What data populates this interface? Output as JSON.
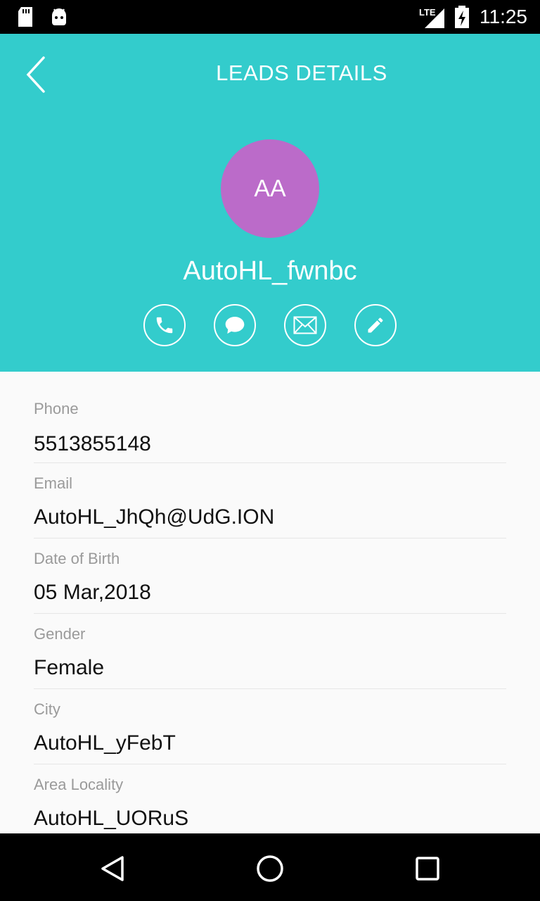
{
  "status_bar": {
    "network": "LTE",
    "time": "11:25"
  },
  "header": {
    "title": "LEADS DETAILS",
    "avatar_initials": "AA",
    "avatar_color": "#bb6bc9",
    "name": "AutoHL_fwnbc",
    "background_color": "#33cccc",
    "actions": [
      "phone-icon",
      "chat-icon",
      "mail-icon",
      "edit-icon"
    ]
  },
  "fields": [
    {
      "label": "Phone",
      "value": "5513855148"
    },
    {
      "label": "Email",
      "value": "AutoHL_JhQh@UdG.ION"
    },
    {
      "label": "Date of Birth",
      "value": "05 Mar,2018"
    },
    {
      "label": "Gender",
      "value": "Female"
    },
    {
      "label": "City",
      "value": "AutoHL_yFebT"
    },
    {
      "label": "Area Locality",
      "value": "AutoHL_UORuS"
    }
  ]
}
